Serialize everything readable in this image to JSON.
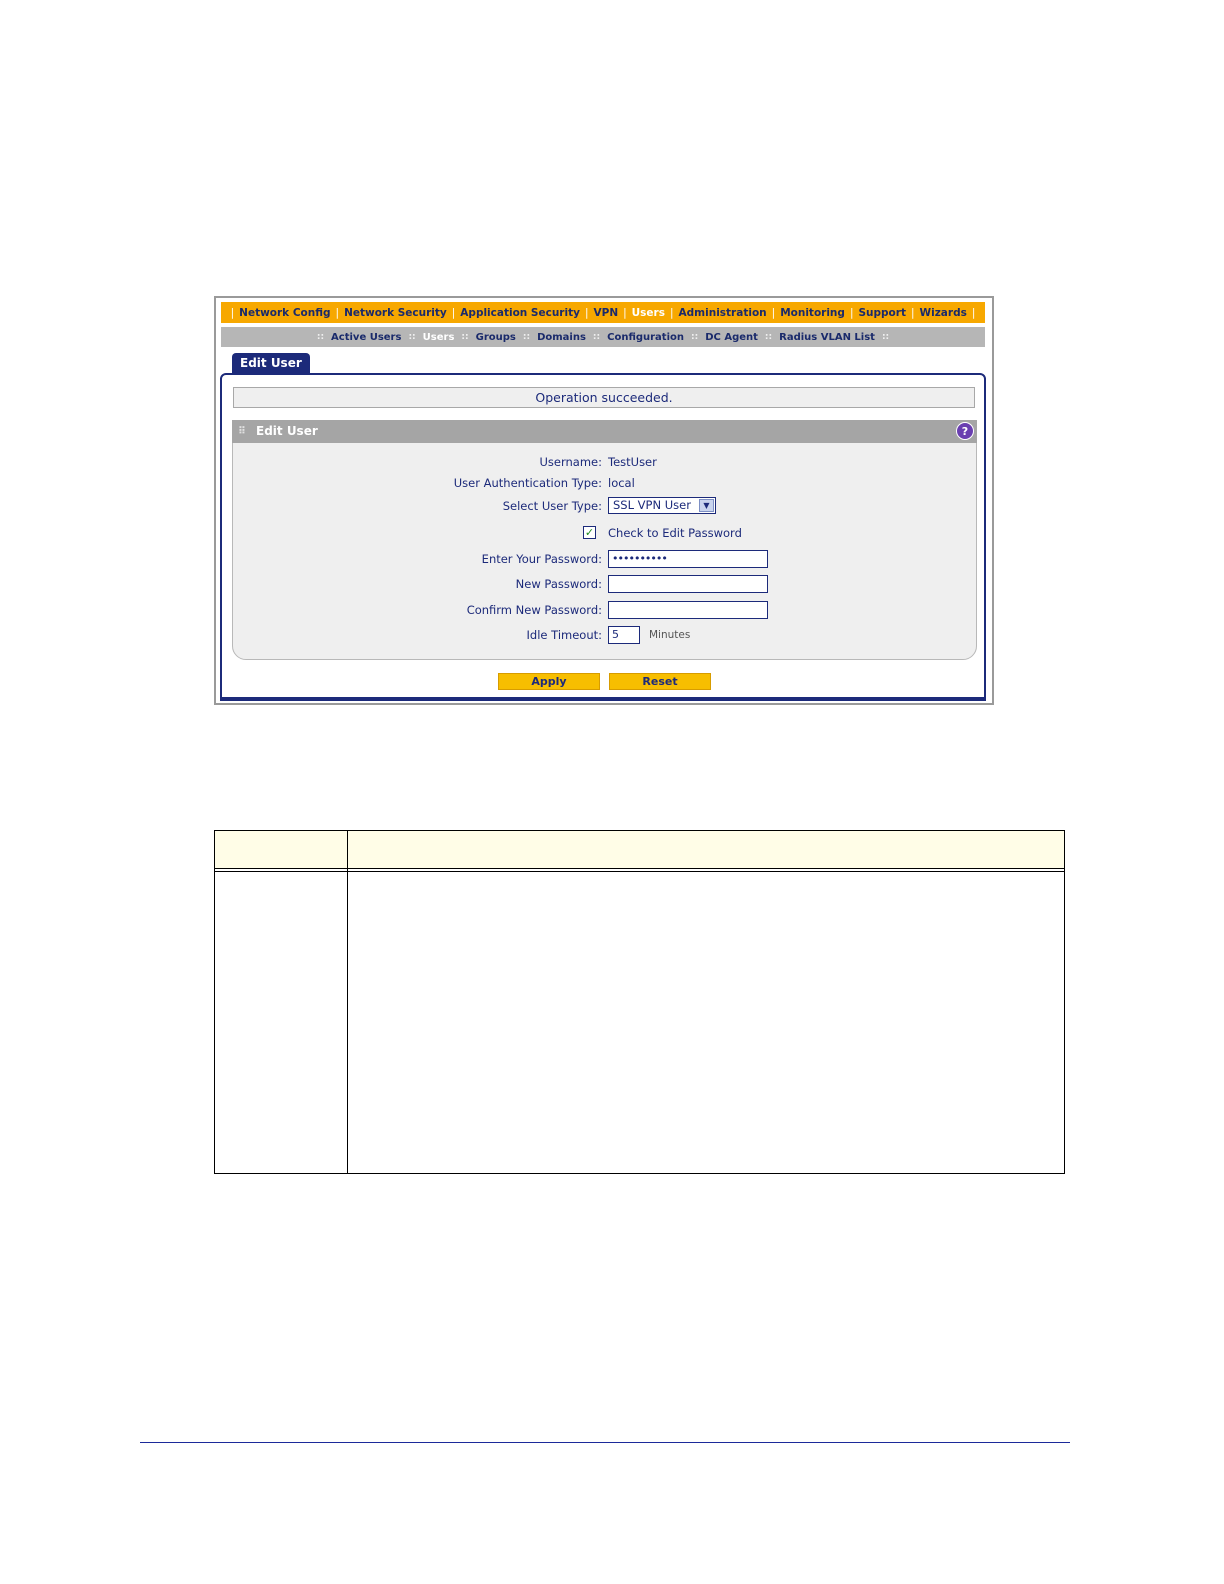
{
  "topnav": {
    "items": [
      {
        "label": "Network Config",
        "active": false
      },
      {
        "label": "Network Security",
        "active": false
      },
      {
        "label": "Application Security",
        "active": false
      },
      {
        "label": "VPN",
        "active": false
      },
      {
        "label": "Users",
        "active": true
      },
      {
        "label": "Administration",
        "active": false
      },
      {
        "label": "Monitoring",
        "active": false
      },
      {
        "label": "Support",
        "active": false
      },
      {
        "label": "Wizards",
        "active": false
      }
    ]
  },
  "subnav": {
    "items": [
      {
        "label": "Active Users",
        "active": false
      },
      {
        "label": "Users",
        "active": true
      },
      {
        "label": "Groups",
        "active": false
      },
      {
        "label": "Domains",
        "active": false
      },
      {
        "label": "Configuration",
        "active": false
      },
      {
        "label": "DC Agent",
        "active": false
      },
      {
        "label": "Radius VLAN List",
        "active": false
      }
    ]
  },
  "tab": {
    "label": "Edit User"
  },
  "status": {
    "message": "Operation succeeded."
  },
  "section": {
    "title": "Edit User",
    "help_icon": "question-icon"
  },
  "form": {
    "username_label": "Username:",
    "username_value": "TestUser",
    "auth_type_label": "User Authentication Type:",
    "auth_type_value": "local",
    "user_type_label": "Select User Type:",
    "user_type_value": "SSL VPN User",
    "edit_password_checked": true,
    "edit_password_label": "Check to Edit Password",
    "enter_password_label": "Enter Your Password:",
    "enter_password_value": "••••••••••",
    "new_password_label": "New Password:",
    "new_password_value": "",
    "confirm_password_label": "Confirm New Password:",
    "confirm_password_value": "",
    "idle_timeout_label": "Idle Timeout:",
    "idle_timeout_value": "5",
    "idle_timeout_units": "Minutes"
  },
  "buttons": {
    "apply": "Apply",
    "reset": "Reset"
  },
  "colors": {
    "accent": "#f7a800",
    "navy": "#1c2a7a",
    "panel": "#efefef"
  }
}
